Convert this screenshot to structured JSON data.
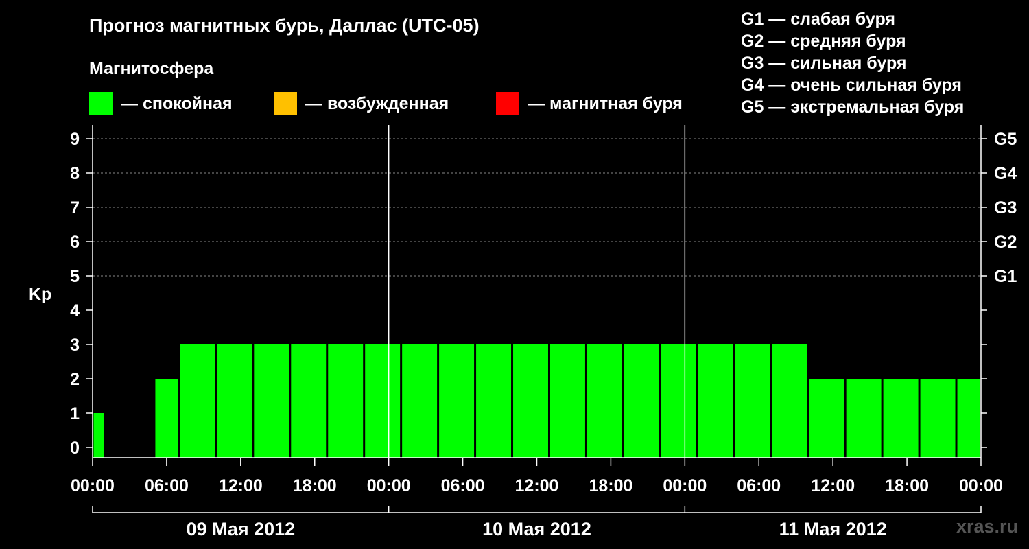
{
  "title": "Прогноз магнитных бурь, Даллас (UTC-05)",
  "subtitle": "Магнитосфера",
  "legend": [
    {
      "color": "#00ff00",
      "label": "— спокойная"
    },
    {
      "color": "#ffc000",
      "label": "— возбужденная"
    },
    {
      "color": "#ff0000",
      "label": "— магнитная буря"
    }
  ],
  "g_scale": [
    "G1 — слабая буря",
    "G2 — средняя буря",
    "G3 — сильная буря",
    "G4 — очень сильная буря",
    "G5 — экстремальная буря"
  ],
  "watermark": "xras.ru",
  "chart_data": {
    "type": "bar",
    "ylabel": "Kp",
    "ylim": [
      0,
      9
    ],
    "yticks": [
      "0",
      "1",
      "2",
      "3",
      "4",
      "5",
      "6",
      "7",
      "8",
      "9"
    ],
    "right_ticks": [
      {
        "value": 5,
        "label": "G1"
      },
      {
        "value": 6,
        "label": "G2"
      },
      {
        "value": 7,
        "label": "G3"
      },
      {
        "value": 8,
        "label": "G4"
      },
      {
        "value": 9,
        "label": "G5"
      }
    ],
    "grid": "dashed horizontal lines at Kp 5–9",
    "xticks": [
      "00:00",
      "06:00",
      "12:00",
      "18:00",
      "00:00",
      "06:00",
      "12:00",
      "18:00",
      "00:00",
      "06:00",
      "12:00",
      "18:00",
      "00:00"
    ],
    "days": [
      "09 Мая 2012",
      "10 Мая 2012",
      "11 Мая 2012"
    ],
    "bars": [
      {
        "start": "2012-05-09 00:00",
        "end": "2012-05-09 01:00",
        "kp": 1,
        "color": "#00ff00"
      },
      {
        "start": "2012-05-09 01:00",
        "end": "2012-05-09 04:00",
        "kp": 0,
        "color": "#00ff00"
      },
      {
        "start": "2012-05-09 05:00",
        "end": "2012-05-09 07:00",
        "kp": 2,
        "color": "#00ff00"
      },
      {
        "start": "2012-05-09 07:00",
        "end": "2012-05-09 10:00",
        "kp": 3,
        "color": "#00ff00"
      },
      {
        "start": "2012-05-09 10:00",
        "end": "2012-05-09 13:00",
        "kp": 3,
        "color": "#00ff00"
      },
      {
        "start": "2012-05-09 13:00",
        "end": "2012-05-09 16:00",
        "kp": 3,
        "color": "#00ff00"
      },
      {
        "start": "2012-05-09 16:00",
        "end": "2012-05-09 19:00",
        "kp": 3,
        "color": "#00ff00"
      },
      {
        "start": "2012-05-09 19:00",
        "end": "2012-05-09 22:00",
        "kp": 3,
        "color": "#00ff00"
      },
      {
        "start": "2012-05-09 22:00",
        "end": "2012-05-10 01:00",
        "kp": 3,
        "color": "#00ff00"
      },
      {
        "start": "2012-05-10 01:00",
        "end": "2012-05-10 04:00",
        "kp": 3,
        "color": "#00ff00"
      },
      {
        "start": "2012-05-10 04:00",
        "end": "2012-05-10 07:00",
        "kp": 3,
        "color": "#00ff00"
      },
      {
        "start": "2012-05-10 07:00",
        "end": "2012-05-10 10:00",
        "kp": 3,
        "color": "#00ff00"
      },
      {
        "start": "2012-05-10 10:00",
        "end": "2012-05-10 13:00",
        "kp": 3,
        "color": "#00ff00"
      },
      {
        "start": "2012-05-10 13:00",
        "end": "2012-05-10 16:00",
        "kp": 3,
        "color": "#00ff00"
      },
      {
        "start": "2012-05-10 16:00",
        "end": "2012-05-10 19:00",
        "kp": 3,
        "color": "#00ff00"
      },
      {
        "start": "2012-05-10 19:00",
        "end": "2012-05-10 22:00",
        "kp": 3,
        "color": "#00ff00"
      },
      {
        "start": "2012-05-10 22:00",
        "end": "2012-05-11 01:00",
        "kp": 3,
        "color": "#00ff00"
      },
      {
        "start": "2012-05-11 01:00",
        "end": "2012-05-11 04:00",
        "kp": 3,
        "color": "#00ff00"
      },
      {
        "start": "2012-05-11 04:00",
        "end": "2012-05-11 07:00",
        "kp": 3,
        "color": "#00ff00"
      },
      {
        "start": "2012-05-11 07:00",
        "end": "2012-05-11 10:00",
        "kp": 3,
        "color": "#00ff00"
      },
      {
        "start": "2012-05-11 10:00",
        "end": "2012-05-11 13:00",
        "kp": 2,
        "color": "#00ff00"
      },
      {
        "start": "2012-05-11 13:00",
        "end": "2012-05-11 16:00",
        "kp": 2,
        "color": "#00ff00"
      },
      {
        "start": "2012-05-11 16:00",
        "end": "2012-05-11 19:00",
        "kp": 2,
        "color": "#00ff00"
      },
      {
        "start": "2012-05-11 19:00",
        "end": "2012-05-11 22:00",
        "kp": 2,
        "color": "#00ff00"
      },
      {
        "start": "2012-05-11 22:00",
        "end": "2012-05-12 00:00",
        "kp": 2,
        "color": "#00ff00"
      }
    ]
  }
}
